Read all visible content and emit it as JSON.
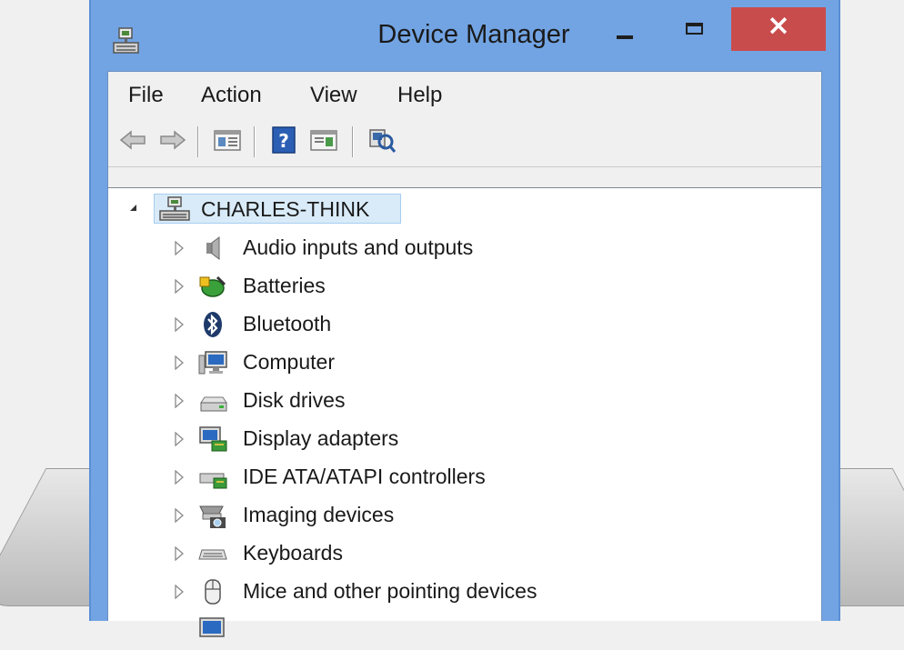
{
  "window": {
    "title": "Device Manager",
    "close_glyph": "×"
  },
  "menu": [
    "File",
    "Action",
    "View",
    "Help"
  ],
  "toolbar": [
    {
      "icon": "back-arrow-icon"
    },
    {
      "icon": "forward-arrow-icon"
    },
    {
      "icon": "show-hide-console-tree-icon"
    },
    {
      "icon": "help-icon",
      "glyph": "?"
    },
    {
      "icon": "show-action-pane-icon"
    },
    {
      "icon": "scan-hardware-changes-icon"
    }
  ],
  "tree": {
    "root": {
      "label": "CHARLES-THINK",
      "icon": "computer-network-icon"
    },
    "categories": [
      {
        "label": "Audio inputs and outputs",
        "icon": "speaker-icon"
      },
      {
        "label": "Batteries",
        "icon": "battery-icon"
      },
      {
        "label": "Bluetooth",
        "icon": "bluetooth-icon"
      },
      {
        "label": "Computer",
        "icon": "computer-icon"
      },
      {
        "label": "Disk drives",
        "icon": "disk-drive-icon"
      },
      {
        "label": "Display adapters",
        "icon": "display-adapter-icon"
      },
      {
        "label": "IDE ATA/ATAPI controllers",
        "icon": "ide-controller-icon"
      },
      {
        "label": "Imaging devices",
        "icon": "camera-icon"
      },
      {
        "label": "Keyboards",
        "icon": "keyboard-icon"
      },
      {
        "label": "Mice and other pointing devices",
        "icon": "mouse-icon"
      }
    ]
  },
  "colors": {
    "titlebar": "#72a4e3",
    "close_button": "#c94c4d",
    "selection": "#d9ebf9"
  }
}
